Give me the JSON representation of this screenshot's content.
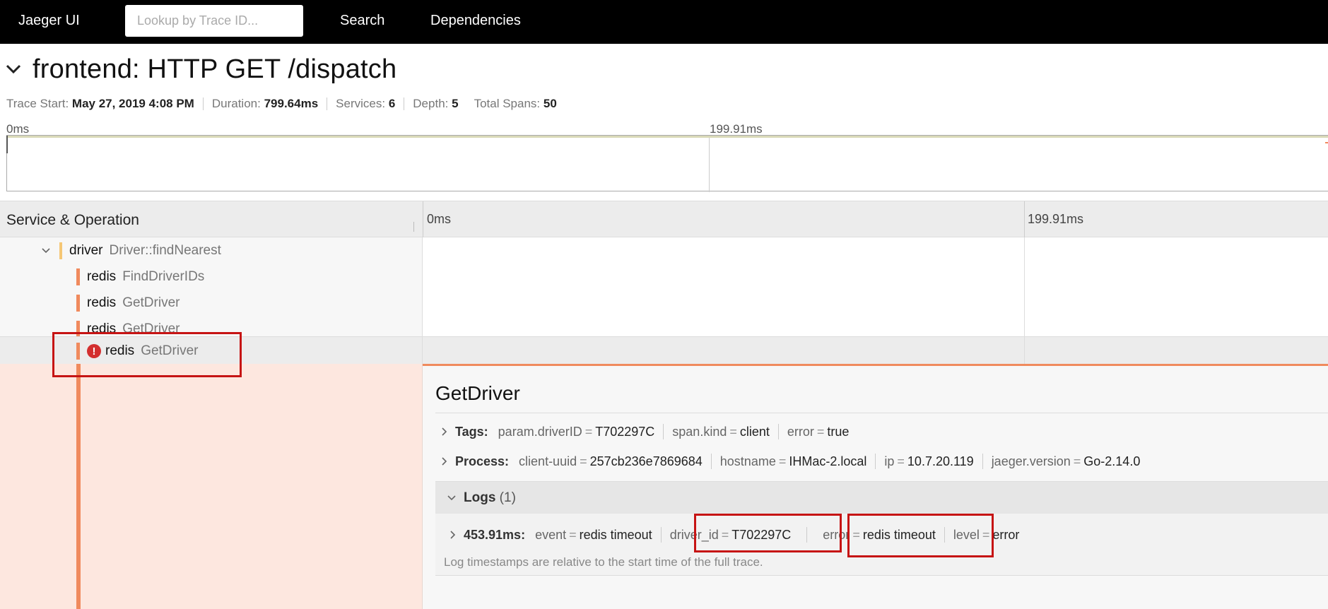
{
  "nav": {
    "brand": "Jaeger UI",
    "lookup_placeholder": "Lookup by Trace ID...",
    "search": "Search",
    "dependencies": "Dependencies"
  },
  "trace": {
    "title": "frontend: HTTP GET /dispatch",
    "meta": {
      "trace_start_label": "Trace Start:",
      "trace_start_value": "May 27, 2019 4:08 PM",
      "duration_label": "Duration:",
      "duration_value": "799.64ms",
      "services_label": "Services:",
      "services_value": "6",
      "depth_label": "Depth:",
      "depth_value": "5",
      "total_spans_label": "Total Spans:",
      "total_spans_value": "50"
    },
    "minimap": {
      "tick0": "0ms",
      "tick1": "199.91ms"
    }
  },
  "tree": {
    "header": "Service & Operation",
    "tick0": "0ms",
    "tick1": "199.91ms",
    "rows": [
      {
        "service": "driver",
        "operation": "Driver::findNearest",
        "bar_color": "#f5c775"
      },
      {
        "service": "redis",
        "operation": "FindDriverIDs",
        "bar_color": "#f08a5d"
      },
      {
        "service": "redis",
        "operation": "GetDriver",
        "bar_color": "#f08a5d"
      },
      {
        "service": "redis",
        "operation": "GetDriver",
        "bar_color": "#f08a5d"
      },
      {
        "service": "redis",
        "operation": "GetDriver",
        "bar_color": "#f08a5d",
        "error": true
      }
    ]
  },
  "detail": {
    "title": "GetDriver",
    "tags": {
      "label": "Tags:",
      "items": [
        {
          "k": "param.driverID",
          "v": "T702297C"
        },
        {
          "k": "span.kind",
          "v": "client"
        },
        {
          "k": "error",
          "v": "true"
        }
      ]
    },
    "process": {
      "label": "Process:",
      "items": [
        {
          "k": "client-uuid",
          "v": "257cb236e7869684"
        },
        {
          "k": "hostname",
          "v": "IHMac-2.local"
        },
        {
          "k": "ip",
          "v": "10.7.20.119"
        },
        {
          "k": "jaeger.version",
          "v": "Go-2.14.0"
        }
      ]
    },
    "logs": {
      "label": "Logs",
      "count": "(1)",
      "entry": {
        "time": "453.91ms:",
        "items": [
          {
            "k": "event",
            "v": "redis timeout"
          },
          {
            "k": "driver_id",
            "v": "T702297C"
          },
          {
            "k": "error",
            "v": "redis timeout"
          },
          {
            "k": "level",
            "v": "error"
          }
        ]
      },
      "note": "Log timestamps are relative to the start time of the full trace."
    }
  },
  "colors": {
    "accent_error": "#d32f2f",
    "highlight_box": "#c61414",
    "span_redis": "#f08a5d",
    "span_driver": "#f5c775"
  }
}
